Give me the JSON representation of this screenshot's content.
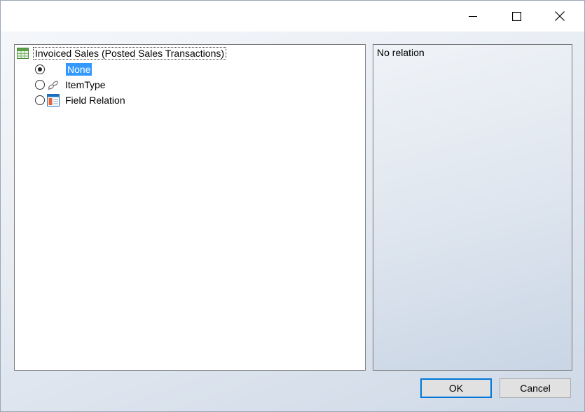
{
  "titlebar": {
    "minimize": "minimize-icon",
    "maximize": "maximize-icon",
    "close": "close-icon"
  },
  "tree": {
    "root": {
      "label": "Invoiced Sales (Posted Sales Transactions)",
      "icon": "table-icon"
    },
    "items": [
      {
        "label": "None",
        "checked": true,
        "selected": true
      },
      {
        "label": "ItemType",
        "checked": false,
        "icon": "link-icon"
      },
      {
        "label": "Field Relation",
        "checked": false,
        "icon": "field-relation-icon"
      }
    ]
  },
  "info": {
    "text": "No relation"
  },
  "buttons": {
    "ok": "OK",
    "cancel": "Cancel"
  },
  "colors": {
    "selection": "#3399ff",
    "default_button_border": "#0078d7"
  }
}
